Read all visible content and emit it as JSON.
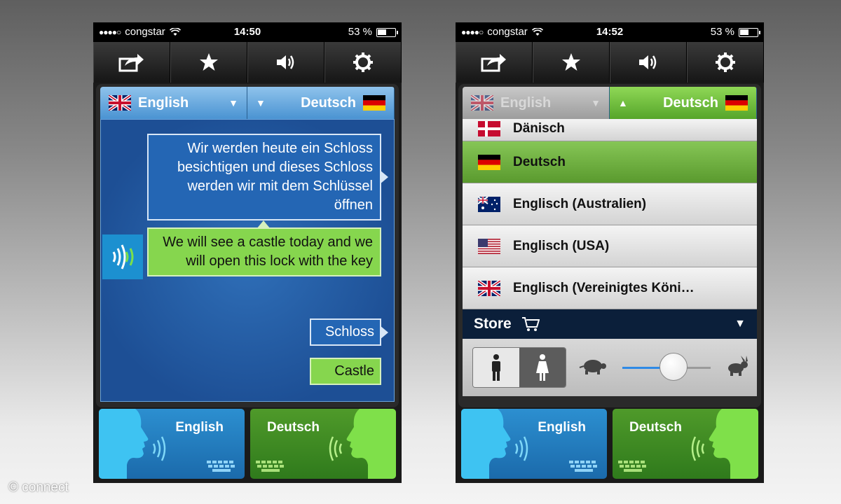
{
  "left_screen": {
    "status": {
      "carrier": "congstar",
      "time": "14:50",
      "battery": "53 %",
      "battery_level": 0.53
    },
    "lang_source": "English",
    "lang_target": "Deutsch",
    "bubble_source": "Wir werden heute ein Schloss besichtigen und dieses Schloss werden wir mit dem Schlüssel öffnen",
    "bubble_translation": "We will see a castle today and we will open this lock with the key",
    "word_source": "Schloss",
    "word_translation": "Castle",
    "speak_source": "English",
    "speak_target": "Deutsch"
  },
  "right_screen": {
    "status": {
      "carrier": "congstar",
      "time": "14:52",
      "battery": "53 %",
      "battery_level": 0.53
    },
    "lang_source": "English",
    "lang_target": "Deutsch",
    "dropdown_items": [
      {
        "label": "Dänisch",
        "flag": "denmark-flag"
      },
      {
        "label": "Deutsch",
        "flag": "germany-flag",
        "selected": true
      },
      {
        "label": "Englisch (Australien)",
        "flag": "australia-flag"
      },
      {
        "label": "Englisch (USA)",
        "flag": "usa-flag"
      },
      {
        "label": "Englisch (Vereinigtes Köni…",
        "flag": "uk-flag"
      }
    ],
    "store_label": "Store",
    "speech_speed": 0.58,
    "speak_source": "English",
    "speak_target": "Deutsch"
  },
  "toolbar_icons": [
    "share-icon",
    "star-icon",
    "speaker-icon",
    "gear-icon"
  ],
  "watermark": "© connect",
  "colors": {
    "english_blue": "#2c8fd0",
    "deutsch_green": "#56a52a",
    "store_navy": "#0b1f3a"
  }
}
